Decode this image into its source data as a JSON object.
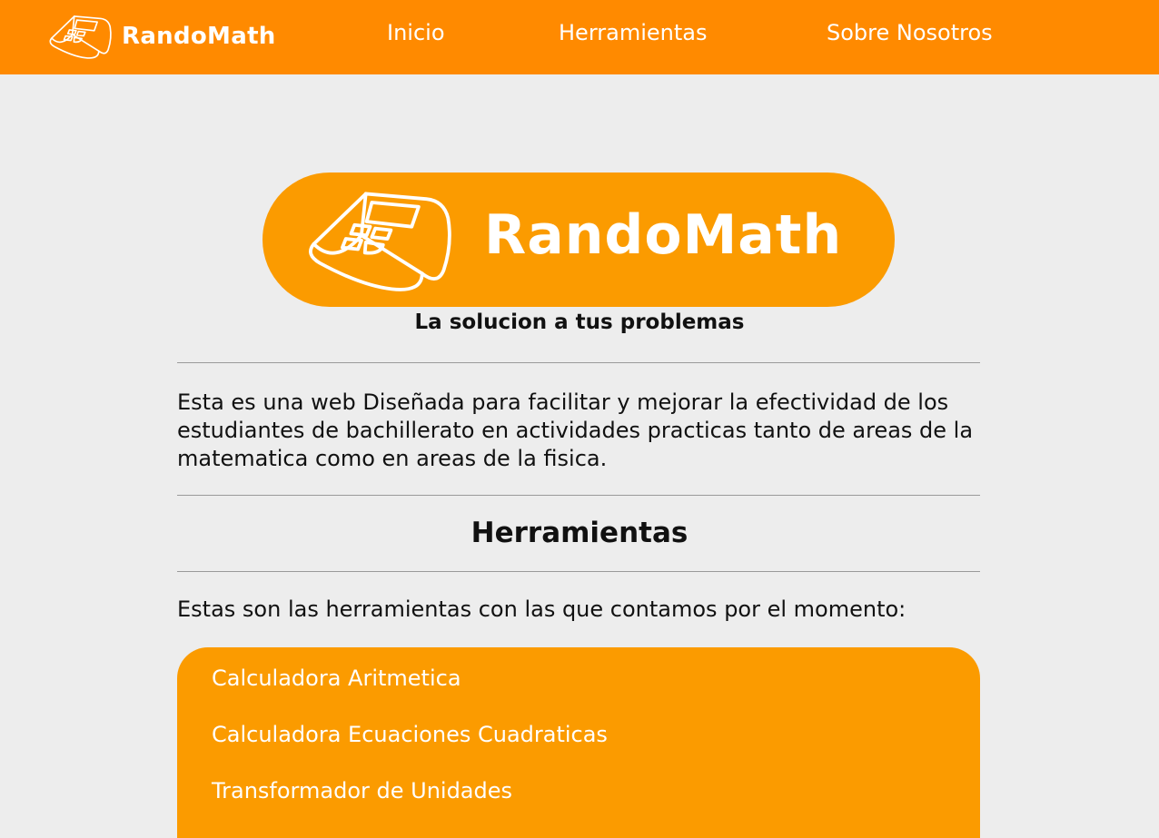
{
  "header": {
    "brand": "RandoMath",
    "logo_icon": "calculator-icon",
    "nav": [
      {
        "label": "Inicio"
      },
      {
        "label": "Herramientas"
      },
      {
        "label": "Sobre Nosotros"
      }
    ]
  },
  "hero": {
    "brand": "RandoMath",
    "tagline": "La solucion a tus problemas"
  },
  "intro": {
    "text": "Esta es una web Diseñada para facilitar y mejorar la efectividad de los estudiantes de bachillerato en actividades practicas tanto de areas de la matematica como en areas de la fisica."
  },
  "tools": {
    "title": "Herramientas",
    "lead": "Estas son las herramientas con las que contamos por el momento:",
    "items": [
      {
        "label": "Calculadora Aritmetica"
      },
      {
        "label": "Calculadora Ecuaciones Cuadraticas"
      },
      {
        "label": "Transformador de Unidades"
      }
    ]
  },
  "colors": {
    "navbar": "#ff8a00",
    "accent": "#fb9b00",
    "background": "#ededed",
    "text": "#111111",
    "on_accent": "#ffffff"
  }
}
